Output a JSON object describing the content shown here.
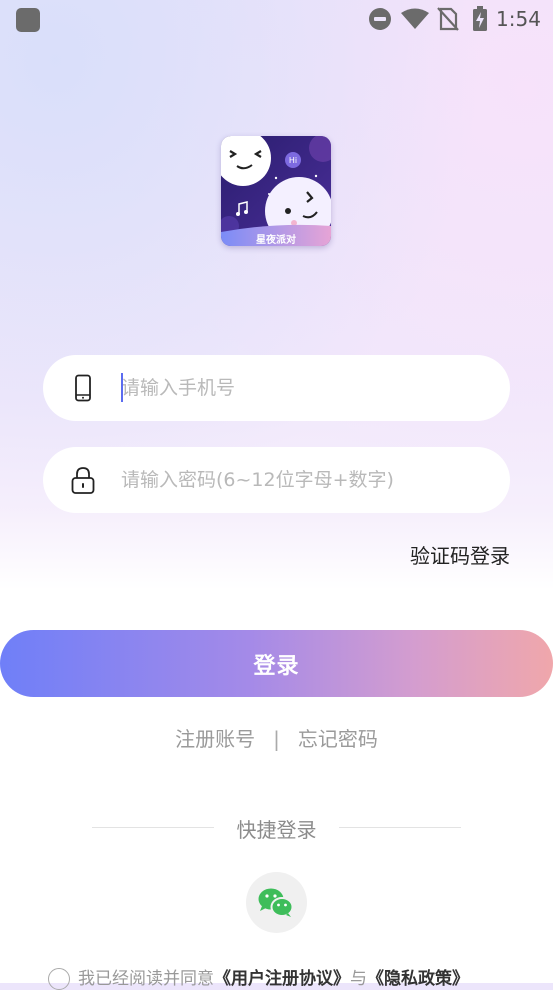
{
  "status_bar": {
    "time": "1:54",
    "icons": [
      "app-notification-icon",
      "do-not-disturb-icon",
      "wifi-icon",
      "no-sim-icon",
      "battery-charging-icon"
    ]
  },
  "app": {
    "logo_text": "星夜派对",
    "logo_bubble": "Hi"
  },
  "form": {
    "phone_placeholder": "请输入手机号",
    "password_placeholder": "请输入密码(6~12位字母+数字)",
    "code_login_label": "验证码登录",
    "login_label": "登录"
  },
  "links": {
    "register": "注册账号",
    "separator": "|",
    "forgot": "忘记密码"
  },
  "quick_login": {
    "label": "快捷登录",
    "providers": [
      "wechat-icon"
    ]
  },
  "agreement": {
    "prefix": "我已经阅读并同意",
    "user_agreement": "《用户注册协议》",
    "conjunction": "与",
    "privacy_policy": "《隐私政策》"
  },
  "colors": {
    "accent": "#6f7ff8",
    "button_gradient_start": "#6f7ff8",
    "button_gradient_end": "#f0a7ab",
    "wechat_green": "#3ebd5a"
  }
}
